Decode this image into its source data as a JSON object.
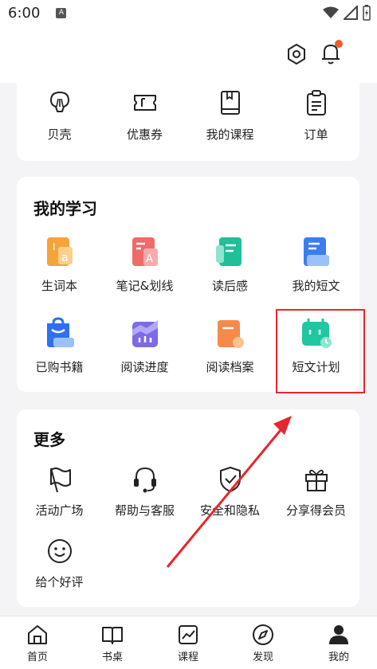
{
  "status_bar": {
    "time": "6:00",
    "badge": "A"
  },
  "top_bar": {
    "notification_color": "#f25b2b"
  },
  "quick_links": [
    {
      "label": "贝壳",
      "icon": "shell-icon"
    },
    {
      "label": "优惠券",
      "icon": "coupon-icon"
    },
    {
      "label": "我的课程",
      "icon": "book-icon"
    },
    {
      "label": "订单",
      "icon": "clipboard-icon"
    }
  ],
  "my_study": {
    "title": "我的学习",
    "items": [
      {
        "label": "生词本",
        "icon": "vocabulary-icon"
      },
      {
        "label": "笔记&划线",
        "icon": "notes-icon"
      },
      {
        "label": "读后感",
        "icon": "review-icon"
      },
      {
        "label": "我的短文",
        "icon": "article-icon"
      },
      {
        "label": "已购书籍",
        "icon": "purchased-books-icon"
      },
      {
        "label": "阅读进度",
        "icon": "reading-progress-icon"
      },
      {
        "label": "阅读档案",
        "icon": "reading-archive-icon"
      },
      {
        "label": "短文计划",
        "icon": "article-plan-icon"
      }
    ]
  },
  "more": {
    "title": "更多",
    "items": [
      {
        "label": "活动广场",
        "icon": "flag-icon"
      },
      {
        "label": "帮助与客服",
        "icon": "headset-icon"
      },
      {
        "label": "安全和隐私",
        "icon": "shield-icon"
      },
      {
        "label": "分享得会员",
        "icon": "gift-icon"
      },
      {
        "label": "给个好评",
        "icon": "smile-icon"
      }
    ]
  },
  "bottom_nav": [
    {
      "label": "首页",
      "icon": "home-icon"
    },
    {
      "label": "书桌",
      "icon": "open-book-icon"
    },
    {
      "label": "课程",
      "icon": "chart-icon"
    },
    {
      "label": "发现",
      "icon": "compass-icon"
    },
    {
      "label": "我的",
      "icon": "person-icon"
    }
  ],
  "colors": {
    "highlight": "#e8262e",
    "accent": "#f25b2b"
  }
}
